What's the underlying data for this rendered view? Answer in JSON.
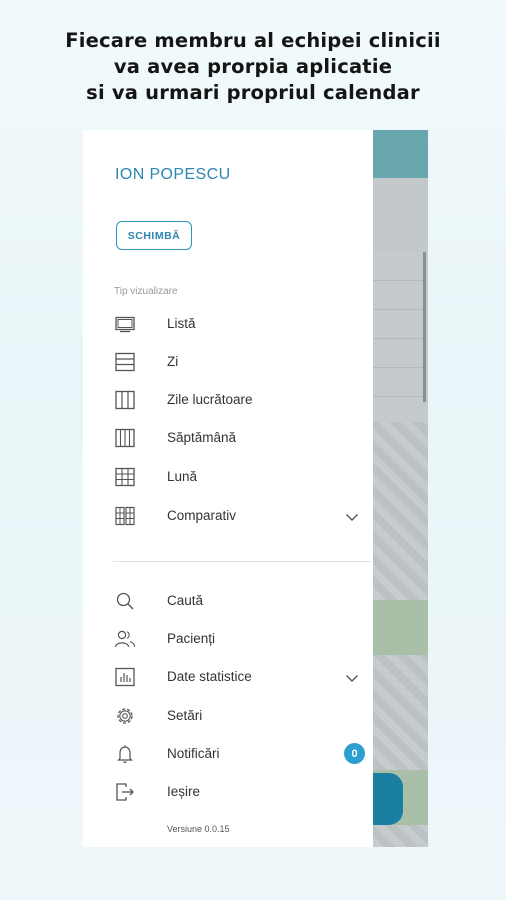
{
  "headline": [
    "Fiecare membru al echipei clinicii",
    "va avea prorpia aplicatie",
    "si va urmari propriul calendar"
  ],
  "drawer": {
    "user_name": "ION POPESCU",
    "switch_button": "SCHIMBĂ",
    "view_type_label": "Tip vizualizare",
    "view_items": [
      {
        "label": "Listă",
        "icon": "list-view-icon"
      },
      {
        "label": "Zi",
        "icon": "day-view-icon"
      },
      {
        "label": "Zile lucrătoare",
        "icon": "workdays-view-icon"
      },
      {
        "label": "Săptămână",
        "icon": "week-view-icon"
      },
      {
        "label": "Lună",
        "icon": "month-view-icon"
      },
      {
        "label": "Comparativ",
        "icon": "comparative-view-icon",
        "expandable": true
      }
    ],
    "menu_items": [
      {
        "label": "Caută",
        "icon": "search-icon"
      },
      {
        "label": "Pacienți",
        "icon": "patients-icon"
      },
      {
        "label": "Date statistice",
        "icon": "statistics-icon",
        "expandable": true
      },
      {
        "label": "Setări",
        "icon": "settings-gear-icon"
      },
      {
        "label": "Notificări",
        "icon": "bell-icon",
        "badge": "0"
      },
      {
        "label": "Ieșire",
        "icon": "logout-icon"
      }
    ],
    "version": "Versiune 0.0.15"
  },
  "colors": {
    "accent": "#2c86b8",
    "badge": "#2ba0cf",
    "header_teal": "#6aa6ad",
    "overlay_gray": "#c9ced0"
  }
}
